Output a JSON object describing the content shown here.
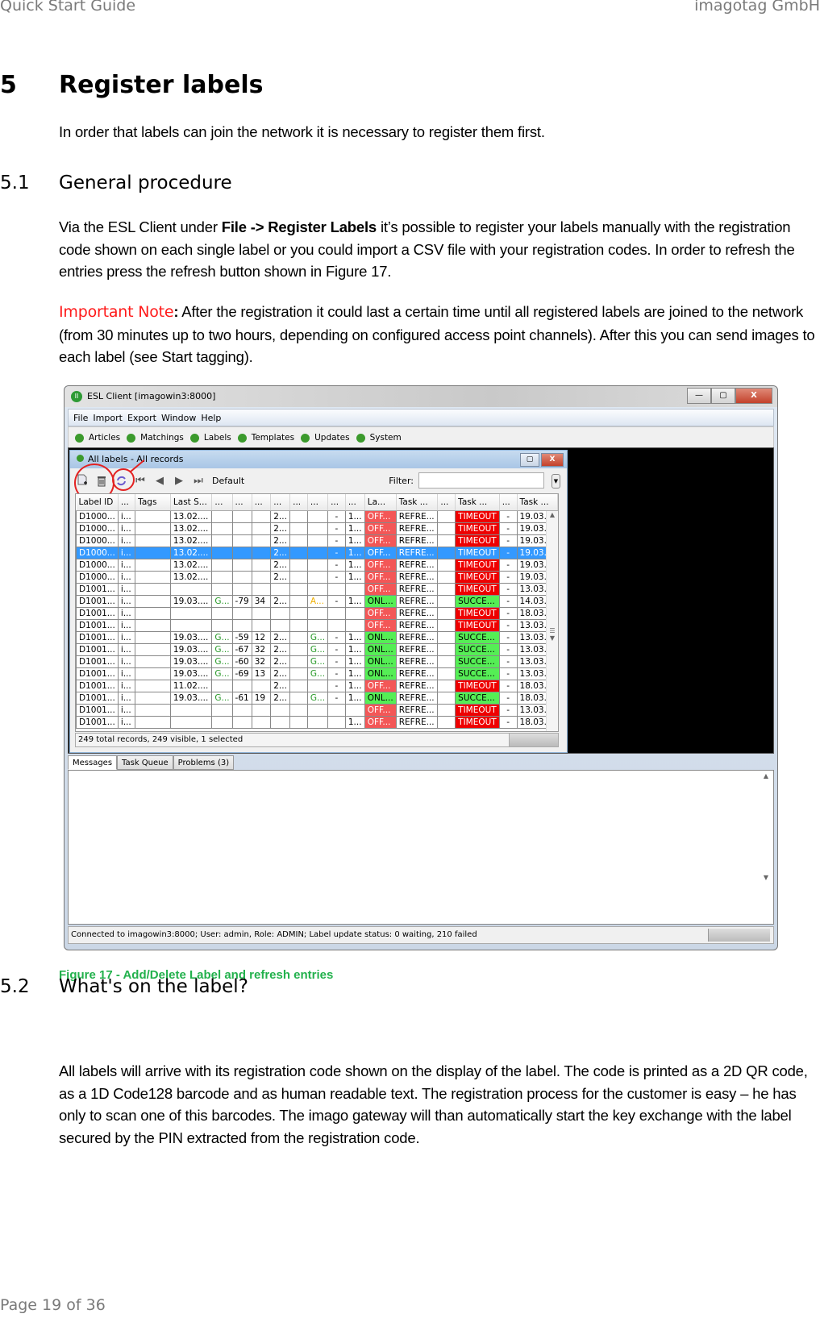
{
  "page_header": {
    "left": "Quick Start Guide",
    "right": "imagotag GmbH"
  },
  "section": {
    "number": "5",
    "title": "Register labels",
    "intro": "In order that labels can join the network it is necessary to register them first."
  },
  "subsection_1": {
    "number": "5.1",
    "title": "General procedure",
    "para_before": "Via the ESL Client under ",
    "para_bold": "File -> Register Labels",
    "para_after": " it’s possible to register your labels manually with the registration code shown on each single label or you could import a CSV file with your registration codes. In order to refresh the entries press the refresh button shown in Figure 17.",
    "note_label": "Important Note",
    "note_colon": ":",
    "note_text": " After the registration it could last a certain time until all registered labels are joined to the network (from 30 minutes up to two hours, depending on configured access point channels). After this you can send images to each label (see Start tagging)."
  },
  "figure": {
    "caption": "Figure 17 - Add/Delete Label and refresh entries",
    "window": {
      "title": "ESL Client [imagowin3:8000]",
      "app_icon": "II",
      "buttons": {
        "minimize": "—",
        "maximize": "▢",
        "close": "X"
      },
      "menu": [
        "File",
        "Import",
        "Export",
        "Window",
        "Help"
      ],
      "nav": [
        "Articles",
        "Matchings",
        "Labels",
        "Templates",
        "Updates",
        "System"
      ],
      "inner": {
        "title": "All labels - All records",
        "toolbar": {
          "add_icon": "add-label-icon",
          "delete_icon": "delete-icon",
          "refresh_icon": "refresh-icon",
          "view": "Default",
          "filter_label": "Filter:",
          "filter_value": ""
        },
        "columns": [
          "Label ID",
          "...",
          "Tags",
          "Last S...",
          "...",
          "...",
          "...",
          "...",
          "...",
          "...",
          "...",
          "...",
          "La...",
          "Task ...",
          "...",
          "Task ...",
          "...",
          "Task ..."
        ],
        "rows": [
          {
            "id": "D1000...",
            "c1": "i...",
            "tags": "",
            "last": "13.02....",
            "g": "",
            "rssi": "",
            "lqi": "",
            "c7": "2...",
            "c8": "",
            "c9": "",
            "c10": "-",
            "c11": "1...",
            "la": "OFF...",
            "task1": "REFRE...",
            "c14": "",
            "task2": "TIMEOUT",
            "c16": "-",
            "task3": "19.03....",
            "selected": false
          },
          {
            "id": "D1000...",
            "c1": "i...",
            "tags": "",
            "last": "13.02....",
            "g": "",
            "rssi": "",
            "lqi": "",
            "c7": "2...",
            "c8": "",
            "c9": "",
            "c10": "-",
            "c11": "1...",
            "la": "OFF...",
            "task1": "REFRE...",
            "c14": "",
            "task2": "TIMEOUT",
            "c16": "-",
            "task3": "19.03....",
            "selected": false
          },
          {
            "id": "D1000...",
            "c1": "i...",
            "tags": "",
            "last": "13.02....",
            "g": "",
            "rssi": "",
            "lqi": "",
            "c7": "2...",
            "c8": "",
            "c9": "",
            "c10": "-",
            "c11": "1...",
            "la": "OFF...",
            "task1": "REFRE...",
            "c14": "",
            "task2": "TIMEOUT",
            "c16": "-",
            "task3": "19.03....",
            "selected": false
          },
          {
            "id": "D1000...",
            "c1": "i...",
            "tags": "",
            "last": "13.02....",
            "g": "",
            "rssi": "",
            "lqi": "",
            "c7": "2...",
            "c8": "",
            "c9": "",
            "c10": "-",
            "c11": "1...",
            "la": "OFF...",
            "task1": "REFRE...",
            "c14": "",
            "task2": "TIMEOUT",
            "c16": "-",
            "task3": "19.03....",
            "selected": true
          },
          {
            "id": "D1000...",
            "c1": "i...",
            "tags": "",
            "last": "13.02....",
            "g": "",
            "rssi": "",
            "lqi": "",
            "c7": "2...",
            "c8": "",
            "c9": "",
            "c10": "-",
            "c11": "1...",
            "la": "OFF...",
            "task1": "REFRE...",
            "c14": "",
            "task2": "TIMEOUT",
            "c16": "-",
            "task3": "19.03....",
            "selected": false
          },
          {
            "id": "D1000...",
            "c1": "i...",
            "tags": "",
            "last": "13.02....",
            "g": "",
            "rssi": "",
            "lqi": "",
            "c7": "2...",
            "c8": "",
            "c9": "",
            "c10": "-",
            "c11": "1...",
            "la": "OFF...",
            "task1": "REFRE...",
            "c14": "",
            "task2": "TIMEOUT",
            "c16": "-",
            "task3": "19.03....",
            "selected": false
          },
          {
            "id": "D1001...",
            "c1": "i...",
            "tags": "",
            "last": "",
            "g": "",
            "rssi": "",
            "lqi": "",
            "c7": "",
            "c8": "",
            "c9": "",
            "c10": "",
            "c11": "",
            "la": "OFF...",
            "task1": "REFRE...",
            "c14": "",
            "task2": "TIMEOUT",
            "c16": "-",
            "task3": "13.03....",
            "selected": false
          },
          {
            "id": "D1001...",
            "c1": "i...",
            "tags": "",
            "last": "19.03....",
            "g": "G...",
            "rssi": "-79",
            "lqi": "34",
            "c7": "2...",
            "c8": "",
            "c9": "A...",
            "c10": "-",
            "c11": "1...",
            "la": "ONL...",
            "task1": "REFRE...",
            "c14": "",
            "task2": "SUCCE...",
            "c16": "-",
            "task3": "14.03....",
            "selected": false
          },
          {
            "id": "D1001...",
            "c1": "i...",
            "tags": "",
            "last": "",
            "g": "",
            "rssi": "",
            "lqi": "",
            "c7": "",
            "c8": "",
            "c9": "",
            "c10": "",
            "c11": "",
            "la": "OFF...",
            "task1": "REFRE...",
            "c14": "",
            "task2": "TIMEOUT",
            "c16": "-",
            "task3": "18.03....",
            "selected": false
          },
          {
            "id": "D1001...",
            "c1": "i...",
            "tags": "",
            "last": "",
            "g": "",
            "rssi": "",
            "lqi": "",
            "c7": "",
            "c8": "",
            "c9": "",
            "c10": "",
            "c11": "",
            "la": "OFF...",
            "task1": "REFRE...",
            "c14": "",
            "task2": "TIMEOUT",
            "c16": "-",
            "task3": "13.03....",
            "selected": false
          },
          {
            "id": "D1001...",
            "c1": "i...",
            "tags": "",
            "last": "19.03....",
            "g": "G...",
            "rssi": "-59",
            "lqi": "12",
            "c7": "2...",
            "c8": "",
            "c9": "G...",
            "c10": "-",
            "c11": "1...",
            "la": "ONL...",
            "task1": "REFRE...",
            "c14": "",
            "task2": "SUCCE...",
            "c16": "-",
            "task3": "13.03....",
            "selected": false
          },
          {
            "id": "D1001...",
            "c1": "i...",
            "tags": "",
            "last": "19.03....",
            "g": "G...",
            "rssi": "-67",
            "lqi": "32",
            "c7": "2...",
            "c8": "",
            "c9": "G...",
            "c10": "-",
            "c11": "1...",
            "la": "ONL...",
            "task1": "REFRE...",
            "c14": "",
            "task2": "SUCCE...",
            "c16": "-",
            "task3": "13.03....",
            "selected": false
          },
          {
            "id": "D1001...",
            "c1": "i...",
            "tags": "",
            "last": "19.03....",
            "g": "G...",
            "rssi": "-60",
            "lqi": "32",
            "c7": "2...",
            "c8": "",
            "c9": "G...",
            "c10": "-",
            "c11": "1...",
            "la": "ONL...",
            "task1": "REFRE...",
            "c14": "",
            "task2": "SUCCE...",
            "c16": "-",
            "task3": "13.03....",
            "selected": false
          },
          {
            "id": "D1001...",
            "c1": "i...",
            "tags": "",
            "last": "19.03....",
            "g": "G...",
            "rssi": "-69",
            "lqi": "13",
            "c7": "2...",
            "c8": "",
            "c9": "G...",
            "c10": "-",
            "c11": "1...",
            "la": "ONL...",
            "task1": "REFRE...",
            "c14": "",
            "task2": "SUCCE...",
            "c16": "-",
            "task3": "13.03....",
            "selected": false
          },
          {
            "id": "D1001...",
            "c1": "i...",
            "tags": "",
            "last": "11.02....",
            "g": "",
            "rssi": "",
            "lqi": "",
            "c7": "2...",
            "c8": "",
            "c9": "",
            "c10": "-",
            "c11": "1...",
            "la": "OFF...",
            "task1": "REFRE...",
            "c14": "",
            "task2": "TIMEOUT",
            "c16": "-",
            "task3": "18.03....",
            "selected": false
          },
          {
            "id": "D1001...",
            "c1": "i...",
            "tags": "",
            "last": "19.03....",
            "g": "G...",
            "rssi": "-61",
            "lqi": "19",
            "c7": "2...",
            "c8": "",
            "c9": "G...",
            "c10": "-",
            "c11": "1...",
            "la": "ONL...",
            "task1": "REFRE...",
            "c14": "",
            "task2": "SUCCE...",
            "c16": "-",
            "task3": "18.03....",
            "selected": false
          },
          {
            "id": "D1001...",
            "c1": "i...",
            "tags": "",
            "last": "",
            "g": "",
            "rssi": "",
            "lqi": "",
            "c7": "",
            "c8": "",
            "c9": "",
            "c10": "",
            "c11": "",
            "la": "OFF...",
            "task1": "REFRE...",
            "c14": "",
            "task2": "TIMEOUT",
            "c16": "-",
            "task3": "13.03....",
            "selected": false
          },
          {
            "id": "D1001...",
            "c1": "i...",
            "tags": "",
            "last": "",
            "g": "",
            "rssi": "",
            "lqi": "",
            "c7": "",
            "c8": "",
            "c9": "",
            "c10": "",
            "c11": "1...",
            "la": "OFF...",
            "task1": "REFRE...",
            "c14": "",
            "task2": "TIMEOUT",
            "c16": "-",
            "task3": "18.03....",
            "selected": false
          }
        ],
        "record_status": "249 total records, 249 visible, 1 selected"
      },
      "tabs": [
        "Messages",
        "Task Queue",
        "Problems (3)"
      ],
      "active_tab": "Messages",
      "status_bar": "Connected to imagowin3:8000; User: admin, Role: ADMIN; Label update status: 0 waiting, 210 failed"
    }
  },
  "subsection_2": {
    "number": "5.2",
    "title": "What's on the label?",
    "para": "All labels will arrive with its registration code shown on the display of the label. The code is printed as a 2D QR code, as a 1D Code128 barcode and as human readable text. The registration process for the customer is easy – he has only to scan one of this barcodes. The imago gateway will than automatically start the key exchange with the label secured by the PIN extracted from the registration code."
  },
  "footer": "Page 19 of 36",
  "colors": {
    "note": "#ff1a1a",
    "caption": "#22b14c",
    "offline": "#f35757",
    "online": "#55ee55",
    "timeout": "#ee0000",
    "selected": "#3399ff"
  }
}
